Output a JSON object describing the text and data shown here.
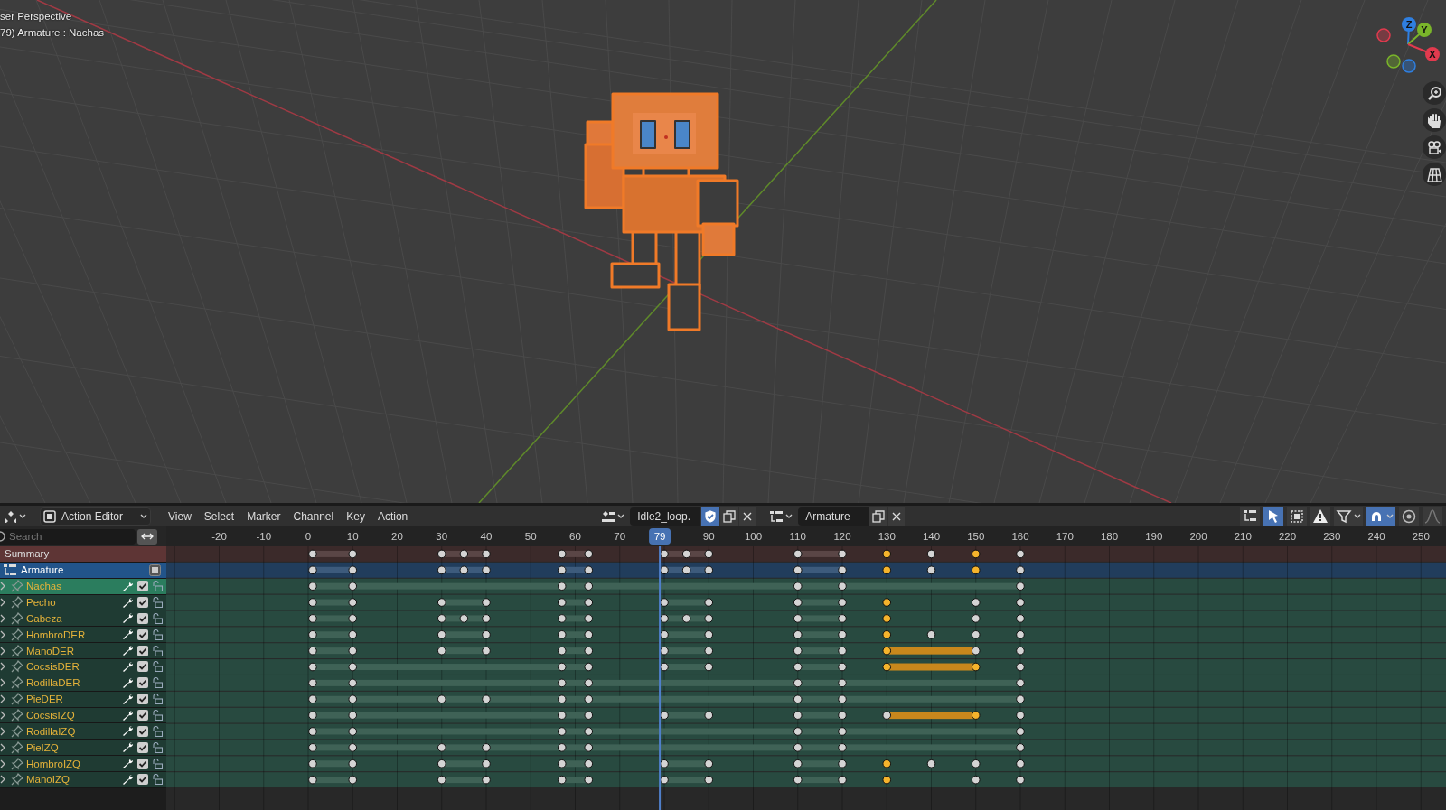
{
  "viewport": {
    "info_lines": [
      "ser Perspective",
      "79) Armature : Nachas"
    ],
    "gizmo_axes": [
      {
        "label": "Z",
        "color": "#2f7fe0"
      },
      {
        "label": "Y",
        "color": "#7ab52a"
      },
      {
        "label": "X",
        "color": "#e23a4e"
      }
    ],
    "nav_buttons": [
      {
        "kind": "zoom"
      },
      {
        "kind": "pan"
      },
      {
        "kind": "camera"
      },
      {
        "kind": "ortho"
      }
    ]
  },
  "editor_header": {
    "editor_type": "Action Editor",
    "menus": [
      "View",
      "Select",
      "Marker",
      "Channel",
      "Key",
      "Action"
    ],
    "action": "Idle2_loop.",
    "fake_user": true,
    "slot": "Armature",
    "tools": [
      {
        "kind": "channels",
        "on": false
      },
      {
        "kind": "select",
        "on": true
      },
      {
        "kind": "box",
        "on": false
      },
      {
        "kind": "warning",
        "on": false
      },
      {
        "kind": "filter",
        "on": false
      },
      {
        "kind": "snap",
        "on": true
      },
      {
        "kind": "proportional",
        "on": false
      },
      {
        "kind": "falloff",
        "on": false
      }
    ]
  },
  "search": {
    "placeholder": "Search"
  },
  "ruler": {
    "labels": [
      "-20",
      "-10",
      "0",
      "10",
      "20",
      "30",
      "40",
      "50",
      "60",
      "70",
      "90",
      "100",
      "110",
      "120",
      "130",
      "140",
      "150",
      "160",
      "170",
      "180",
      "190",
      "200",
      "210",
      "220",
      "230",
      "240",
      "250"
    ],
    "current_frame": "79"
  },
  "channels": [
    {
      "name": "Summary",
      "kind": "summary",
      "keyframes": [
        {
          "selected": false
        },
        {
          "selected": false
        },
        {
          "selected": false
        },
        {
          "selected": false
        },
        {
          "selected": false
        },
        {
          "selected": false
        },
        {
          "selected": false
        },
        {
          "selected": false
        },
        {
          "selected": false
        },
        {
          "selected": false
        },
        {
          "selected": false
        },
        {
          "selected": false
        },
        {
          "selected": true
        },
        {
          "selected": false
        },
        {
          "selected": true
        },
        {
          "selected": false
        }
      ],
      "holds": [
        {
          "selected": false
        },
        {
          "selected": false
        },
        {
          "selected": false
        },
        {
          "selected": false
        },
        {
          "selected": false
        }
      ]
    },
    {
      "name": "Armature",
      "kind": "object",
      "keyframes": [
        {
          "selected": false
        },
        {
          "selected": false
        },
        {
          "selected": false
        },
        {
          "selected": false
        },
        {
          "selected": false
        },
        {
          "selected": false
        },
        {
          "selected": false
        },
        {
          "selected": false
        },
        {
          "selected": false
        },
        {
          "selected": false
        },
        {
          "selected": false
        },
        {
          "selected": false
        },
        {
          "selected": true
        },
        {
          "selected": false
        },
        {
          "selected": true
        },
        {
          "selected": false
        }
      ],
      "holds": [
        {
          "selected": false
        },
        {
          "selected": false
        },
        {
          "selected": false
        },
        {
          "selected": false
        },
        {
          "selected": false
        }
      ]
    },
    {
      "name": "Nachas",
      "kind": "group",
      "selected": true,
      "checked": true,
      "keyframes": [
        {
          "selected": false
        },
        {
          "selected": false
        },
        {
          "selected": false
        },
        {
          "selected": false
        },
        {
          "selected": false
        },
        {
          "selected": false
        },
        {
          "selected": false
        }
      ],
      "holds": [
        {
          "selected": false
        }
      ]
    },
    {
      "name": "Pecho",
      "kind": "group",
      "selected": false,
      "checked": true,
      "keyframes": [
        {
          "selected": false
        },
        {
          "selected": false
        },
        {
          "selected": false
        },
        {
          "selected": false
        },
        {
          "selected": false
        },
        {
          "selected": false
        },
        {
          "selected": false
        },
        {
          "selected": false
        },
        {
          "selected": false
        },
        {
          "selected": false
        },
        {
          "selected": true
        },
        {
          "selected": false
        },
        {
          "selected": false
        }
      ],
      "holds": [
        {
          "selected": false
        },
        {
          "selected": false
        },
        {
          "selected": false
        },
        {
          "selected": false
        },
        {
          "selected": false
        }
      ]
    },
    {
      "name": "Cabeza",
      "kind": "group",
      "selected": false,
      "checked": true,
      "keyframes": [
        {
          "selected": false
        },
        {
          "selected": false
        },
        {
          "selected": false
        },
        {
          "selected": false
        },
        {
          "selected": false
        },
        {
          "selected": false
        },
        {
          "selected": false
        },
        {
          "selected": false
        },
        {
          "selected": false
        },
        {
          "selected": false
        },
        {
          "selected": false
        },
        {
          "selected": false
        },
        {
          "selected": true
        },
        {
          "selected": false
        },
        {
          "selected": false
        }
      ],
      "holds": [
        {
          "selected": false
        },
        {
          "selected": false
        },
        {
          "selected": false
        },
        {
          "selected": false
        },
        {
          "selected": false
        }
      ]
    },
    {
      "name": "HombroDER",
      "kind": "group",
      "selected": false,
      "checked": true,
      "keyframes": [
        {
          "selected": false
        },
        {
          "selected": false
        },
        {
          "selected": false
        },
        {
          "selected": false
        },
        {
          "selected": false
        },
        {
          "selected": false
        },
        {
          "selected": false
        },
        {
          "selected": false
        },
        {
          "selected": false
        },
        {
          "selected": false
        },
        {
          "selected": true
        },
        {
          "selected": false
        },
        {
          "selected": false
        },
        {
          "selected": false
        }
      ],
      "holds": [
        {
          "selected": false
        },
        {
          "selected": false
        },
        {
          "selected": false
        },
        {
          "selected": false
        },
        {
          "selected": false
        }
      ]
    },
    {
      "name": "ManoDER",
      "kind": "group",
      "selected": false,
      "checked": true,
      "keyframes": [
        {
          "selected": false
        },
        {
          "selected": false
        },
        {
          "selected": false
        },
        {
          "selected": false
        },
        {
          "selected": false
        },
        {
          "selected": false
        },
        {
          "selected": false
        },
        {
          "selected": false
        },
        {
          "selected": false
        },
        {
          "selected": false
        },
        {
          "selected": true
        },
        {
          "selected": false
        },
        {
          "selected": false
        }
      ],
      "holds": [
        {
          "selected": false
        },
        {
          "selected": false
        },
        {
          "selected": false
        },
        {
          "selected": false
        },
        {
          "selected": false
        },
        {
          "selected": true
        }
      ]
    },
    {
      "name": "CocsisDER",
      "kind": "group",
      "selected": false,
      "checked": true,
      "keyframes": [
        {
          "selected": false
        },
        {
          "selected": false
        },
        {
          "selected": false
        },
        {
          "selected": false
        },
        {
          "selected": false
        },
        {
          "selected": false
        },
        {
          "selected": false
        },
        {
          "selected": false
        },
        {
          "selected": true
        },
        {
          "selected": true
        },
        {
          "selected": false
        }
      ],
      "holds": [
        {
          "selected": false
        },
        {
          "selected": false
        },
        {
          "selected": false
        },
        {
          "selected": true
        }
      ]
    },
    {
      "name": "RodillaDER",
      "kind": "group",
      "selected": false,
      "checked": true,
      "keyframes": [
        {
          "selected": false
        },
        {
          "selected": false
        },
        {
          "selected": false
        },
        {
          "selected": false
        },
        {
          "selected": false
        },
        {
          "selected": false
        },
        {
          "selected": false
        }
      ],
      "holds": [
        {
          "selected": false
        }
      ]
    },
    {
      "name": "PieDER",
      "kind": "group",
      "selected": false,
      "checked": true,
      "keyframes": [
        {
          "selected": false
        },
        {
          "selected": false
        },
        {
          "selected": false
        },
        {
          "selected": false
        },
        {
          "selected": false
        },
        {
          "selected": false
        },
        {
          "selected": false
        },
        {
          "selected": false
        },
        {
          "selected": false
        }
      ],
      "holds": [
        {
          "selected": false
        }
      ]
    },
    {
      "name": "CocsisIZQ",
      "kind": "group",
      "selected": false,
      "checked": true,
      "keyframes": [
        {
          "selected": false
        },
        {
          "selected": false
        },
        {
          "selected": false
        },
        {
          "selected": false
        },
        {
          "selected": false
        },
        {
          "selected": false
        },
        {
          "selected": false
        },
        {
          "selected": false
        },
        {
          "selected": false
        },
        {
          "selected": true
        },
        {
          "selected": false
        }
      ],
      "holds": [
        {
          "selected": false
        },
        {
          "selected": false
        },
        {
          "selected": false
        },
        {
          "selected": true
        }
      ]
    },
    {
      "name": "RodillaIZQ",
      "kind": "group",
      "selected": false,
      "checked": true,
      "keyframes": [
        {
          "selected": false
        },
        {
          "selected": false
        },
        {
          "selected": false
        },
        {
          "selected": false
        },
        {
          "selected": false
        },
        {
          "selected": false
        },
        {
          "selected": false
        }
      ],
      "holds": [
        {
          "selected": false
        }
      ]
    },
    {
      "name": "PieIZQ",
      "kind": "group",
      "selected": false,
      "checked": true,
      "keyframes": [
        {
          "selected": false
        },
        {
          "selected": false
        },
        {
          "selected": false
        },
        {
          "selected": false
        },
        {
          "selected": false
        },
        {
          "selected": false
        },
        {
          "selected": false
        },
        {
          "selected": false
        },
        {
          "selected": false
        }
      ],
      "holds": [
        {
          "selected": false
        }
      ]
    },
    {
      "name": "HombroIZQ",
      "kind": "group",
      "selected": false,
      "checked": true,
      "keyframes": [
        {
          "selected": false
        },
        {
          "selected": false
        },
        {
          "selected": false
        },
        {
          "selected": false
        },
        {
          "selected": false
        },
        {
          "selected": false
        },
        {
          "selected": false
        },
        {
          "selected": false
        },
        {
          "selected": false
        },
        {
          "selected": false
        },
        {
          "selected": true
        },
        {
          "selected": false
        },
        {
          "selected": false
        },
        {
          "selected": false
        }
      ],
      "holds": [
        {
          "selected": false
        },
        {
          "selected": false
        },
        {
          "selected": false
        },
        {
          "selected": false
        },
        {
          "selected": false
        }
      ]
    },
    {
      "name": "ManoIZQ",
      "kind": "group",
      "selected": false,
      "checked": true,
      "keyframes": [
        {
          "selected": false
        },
        {
          "selected": false
        },
        {
          "selected": false
        },
        {
          "selected": false
        },
        {
          "selected": false
        },
        {
          "selected": false
        },
        {
          "selected": false
        },
        {
          "selected": false
        },
        {
          "selected": false
        },
        {
          "selected": false
        },
        {
          "selected": true
        },
        {
          "selected": false
        },
        {
          "selected": false
        }
      ],
      "holds": [
        {
          "selected": false
        },
        {
          "selected": false
        },
        {
          "selected": false
        },
        {
          "selected": false
        },
        {
          "selected": false
        }
      ]
    }
  ]
}
